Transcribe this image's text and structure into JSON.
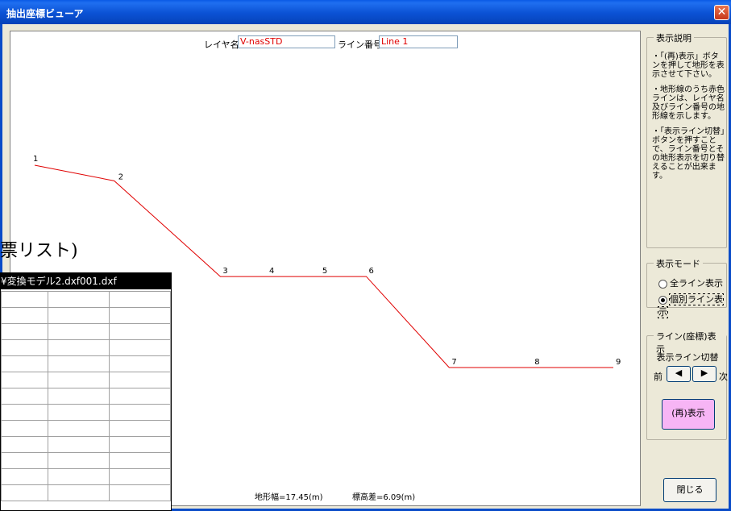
{
  "window": {
    "title": "抽出座標ビューア",
    "close_glyph": "✕"
  },
  "header": {
    "layer_label": "レイヤ名:",
    "layer_value": "V-nasSTD",
    "line_label": "ライン番号:",
    "line_value": "Line 1"
  },
  "profile": {
    "line_color": "#e00000",
    "points": [
      {
        "label": "1",
        "x": 0.0,
        "y": 6.09
      },
      {
        "label": "2",
        "x": 2.4,
        "y": 5.62
      },
      {
        "label": "3",
        "x": 5.6,
        "y": 2.74
      },
      {
        "label": "4",
        "x": 7.0,
        "y": 2.74
      },
      {
        "label": "5",
        "x": 8.6,
        "y": 2.74
      },
      {
        "label": "6",
        "x": 10.0,
        "y": 2.74
      },
      {
        "label": "7",
        "x": 12.5,
        "y": 0.0
      },
      {
        "label": "8",
        "x": 15.0,
        "y": 0.0
      },
      {
        "label": "9",
        "x": 17.45,
        "y": 0.0
      }
    ]
  },
  "footer": {
    "width_text": "地形幅=17.45(m)",
    "height_text": "標高差=6.09(m)"
  },
  "description": {
    "title": "表示説明",
    "paragraphs": [
      "・「(再)表示」ボタンを押して地形を表示させて下さい。",
      "・地形線のうち赤色ラインは、レイヤ名及びライン番号の地形線を示します。",
      "・「表示ライン切替」ボタンを押すことで、ライン番号とその地形表示を切り替えることが出来ます。"
    ]
  },
  "mode": {
    "title": "表示モード",
    "options": [
      "全ライン表示",
      "個別ライン表示"
    ],
    "selected": 1
  },
  "line_display": {
    "title": "ライン(座標)表示",
    "switch_label": "表示ライン切替",
    "prev_label": "前",
    "next_label": "次"
  },
  "buttons": {
    "redraw": "(再)表示",
    "close": "閉じる"
  },
  "background_window": {
    "fragment_text": "票リスト)",
    "header_text": "¥変換モデル2.dxf001.dxf"
  }
}
